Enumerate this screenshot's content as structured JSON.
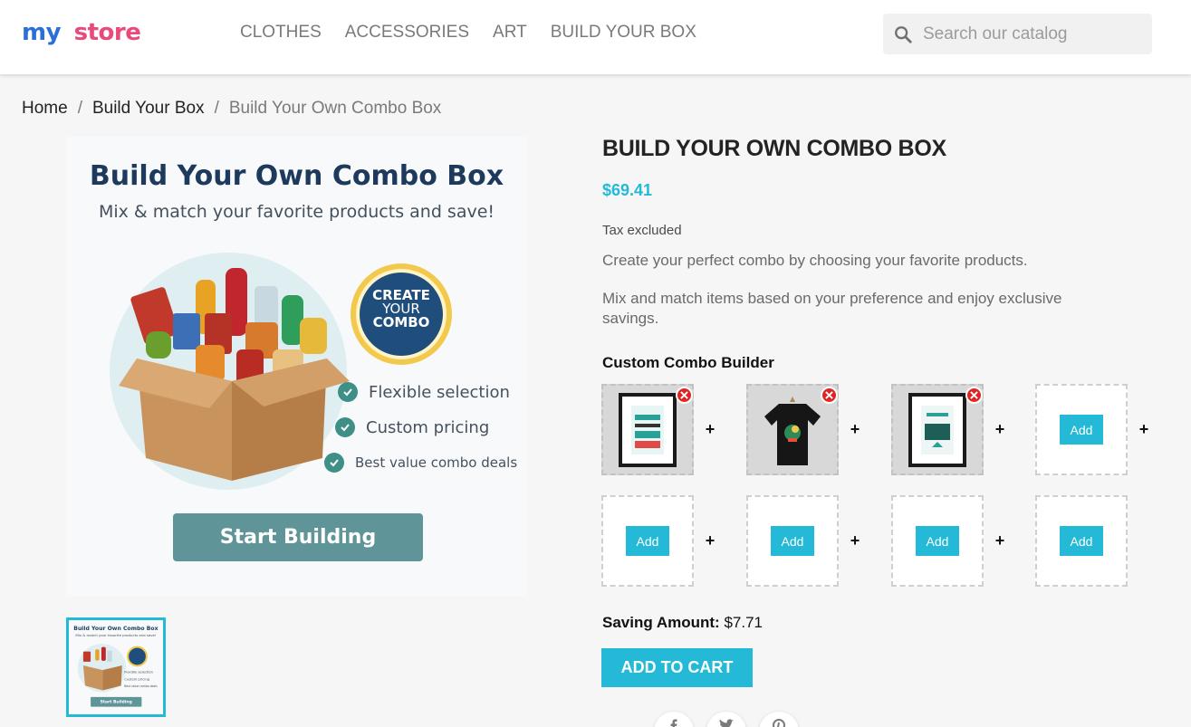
{
  "header": {
    "logo": {
      "part1": "my",
      "part2": "store"
    },
    "nav": [
      "CLOTHES",
      "ACCESSORIES",
      "ART",
      "BUILD YOUR BOX"
    ],
    "search": {
      "placeholder": "Search our catalog",
      "value": ""
    }
  },
  "breadcrumb": {
    "items": [
      "Home",
      "Build Your Box",
      "Build Your Own Combo Box"
    ],
    "separator": "/"
  },
  "image": {
    "title": "Build Your Own Combo Box",
    "subtitle": "Mix & match your favorite products and save!",
    "badge": [
      "CREATE",
      "YOUR",
      "COMBO"
    ],
    "features": [
      "Flexible selection",
      "Custom pricing",
      "Best value combo deals"
    ],
    "button": "Start Building"
  },
  "product": {
    "title": "BUILD YOUR OWN COMBO BOX",
    "price": "$69.41",
    "tax": "Tax excluded",
    "description1": "Create your perfect combo by choosing your favorite products.",
    "description2": "Mix and match items based on your preference and enjoy exclusive savings."
  },
  "builder": {
    "title": "Custom Combo Builder",
    "add_label": "Add",
    "plus": "+",
    "slots": [
      {
        "filled": true,
        "item": "poster-best-is-yet-to-come"
      },
      {
        "filled": true,
        "item": "black-tshirt"
      },
      {
        "filled": true,
        "item": "poster-adventure-begins"
      },
      {
        "filled": false
      },
      {
        "filled": false
      },
      {
        "filled": false
      },
      {
        "filled": false
      },
      {
        "filled": false
      }
    ]
  },
  "saving": {
    "label": "Saving Amount:",
    "value": "$7.71"
  },
  "cart_button": "ADD TO CART",
  "social": [
    "facebook-icon",
    "twitter-icon",
    "pinterest-icon"
  ],
  "colors": {
    "accent": "#24b9d7",
    "remove": "#e02424",
    "dark_title": "#1d3a5c",
    "button_teal": "#5f9598"
  }
}
